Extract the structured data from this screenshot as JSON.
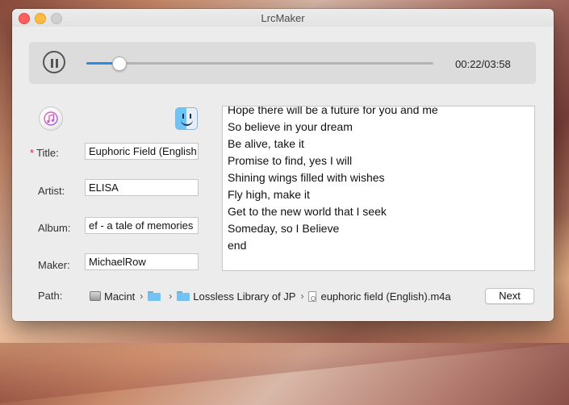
{
  "window": {
    "title": "LrcMaker"
  },
  "player": {
    "progress": 0.093,
    "time": "00:22/03:58",
    "accent_color": "#2d8be6",
    "play_icon": "pause-icon"
  },
  "icons": {
    "itunes": "itunes-icon",
    "finder": "finder-icon"
  },
  "form": {
    "title_required": "*",
    "title_label": "Title:",
    "title_value": "Euphoric Field (English",
    "artist_label": "Artist:",
    "artist_value": "ELISA",
    "album_label": "Album:",
    "album_value": "ef - a tale of memories",
    "maker_label": "Maker:",
    "maker_value": "MichaelRow"
  },
  "lyrics": [
    "Hope there will be a future for you and me",
    "So believe in your dream",
    "Be alive, take it",
    "Promise to find, yes I will",
    "Shining wings filled with wishes",
    "Fly high, make it",
    "Get to the new world that I seek",
    "Someday, so I Believe",
    "end"
  ],
  "path": {
    "label": "Path:",
    "disk": "Macint",
    "separator": "›",
    "folder2": "Lossless Library of JP",
    "file": "euphoric field (English).m4a"
  },
  "next_label": "Next"
}
